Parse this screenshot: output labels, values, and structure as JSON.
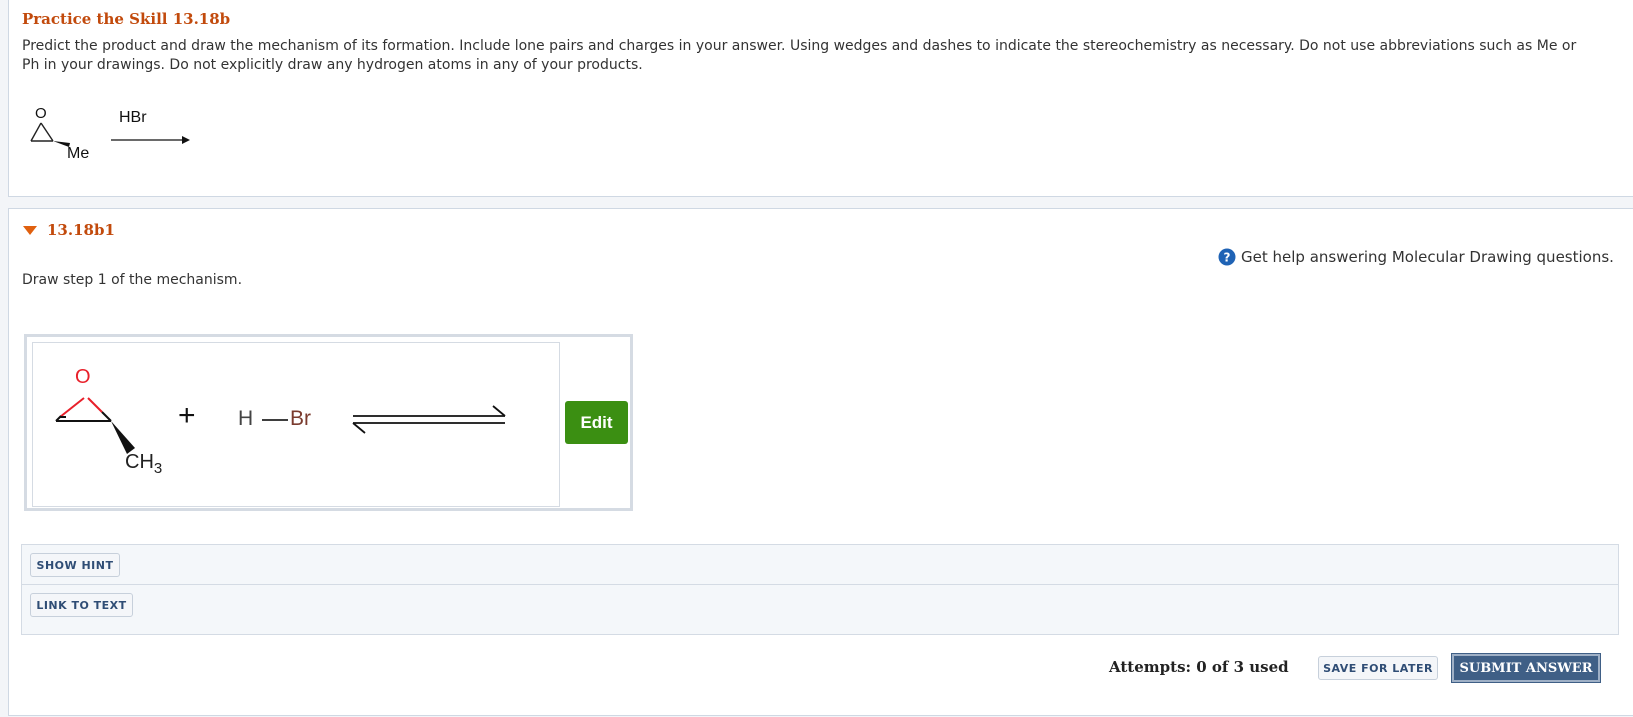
{
  "problem": {
    "title": "Practice the Skill 13.18b",
    "instructions": "Predict the product and draw the mechanism of its formation. Include lone pairs and charges in your answer. Using wedges and dashes to indicate the stereochemistry as necessary. Do not use abbreviations such as Me or Ph in your drawings. Do not explicitly draw any hydrogen atoms in any of your products.",
    "reagent": "HBr",
    "substituent": "Me"
  },
  "subquestion": {
    "id": "13.18b1",
    "help_text": "Get help answering Molecular Drawing questions.",
    "prompt": "Draw step 1 of the mechanism.",
    "drawing": {
      "oxygen": "O",
      "plus": "+",
      "h_atom": "H",
      "br_atom": "Br",
      "methyl": "CH",
      "methyl_sub": "3"
    },
    "edit_label": "Edit"
  },
  "hints": {
    "show_hint": "SHOW HINT",
    "link_to_text": "LINK TO TEXT"
  },
  "footer": {
    "attempts": "Attempts: 0 of 3 used",
    "save_for_later": "SAVE FOR LATER",
    "submit_answer": "SUBMIT ANSWER"
  },
  "colors": {
    "title": "#c24a0c",
    "oxygen": "#e8202a",
    "bromine": "#7a3b2e",
    "edit_button": "#3b8f12",
    "submit_button": "#3f5f86"
  },
  "icons": [
    "triangle-down-icon",
    "help-icon",
    "equilibrium-arrow-icon",
    "reaction-arrow-icon"
  ]
}
